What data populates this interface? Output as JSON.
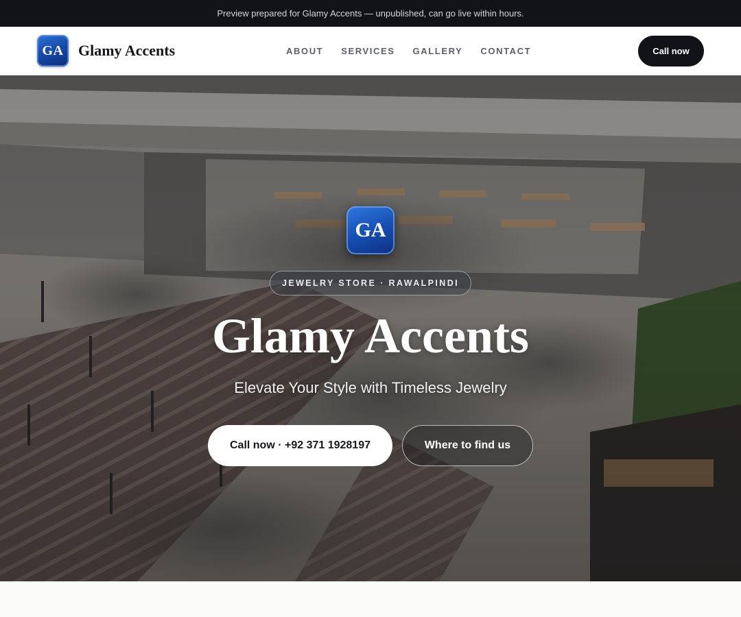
{
  "announcement": {
    "text": "Preview prepared for Glamy Accents — unpublished, can go live within hours."
  },
  "header": {
    "logo_initials": "GA",
    "brand_name": "Glamy Accents",
    "nav": [
      {
        "label": "ABOUT"
      },
      {
        "label": "SERVICES"
      },
      {
        "label": "GALLERY"
      },
      {
        "label": "CONTACT"
      }
    ],
    "call_label": "Call now"
  },
  "hero": {
    "badge_initials": "GA",
    "eyebrow": "JEWELRY STORE · RAWALPINDI",
    "title": "Glamy Accents",
    "subtitle": "Elevate Your Style with Timeless Jewelry",
    "cta_primary": "Call now · +92 371 1928197",
    "cta_secondary": "Where to find us"
  },
  "colors": {
    "announcement_bg": "#121319",
    "header_bg": "#ffffff",
    "brand_gradient_top": "#2e73d6",
    "brand_gradient_bottom": "#0d2f7a",
    "nav_text": "#5b5e6a",
    "dark_button": "#121319",
    "page_bg": "#fafaf8"
  }
}
